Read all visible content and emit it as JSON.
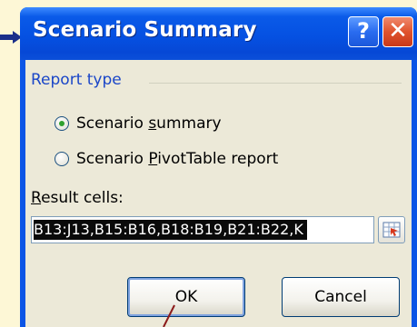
{
  "dialog": {
    "title": "Scenario Summary",
    "help_button": "?",
    "close_button": "✕"
  },
  "report_type": {
    "group_label": "Report type",
    "options": [
      {
        "prefix": "Scenario ",
        "accel": "s",
        "suffix": "ummary",
        "selected": true
      },
      {
        "prefix": "Scenario ",
        "accel": "P",
        "suffix": "ivotTable report",
        "selected": false
      }
    ]
  },
  "result_cells": {
    "label_accel": "R",
    "label_rest": "esult cells:",
    "value": "B13:J13,B15:B16,B18:B19,B21:B22,K"
  },
  "buttons": {
    "ok_label": "OK",
    "cancel_label": "Cancel"
  },
  "colors": {
    "page_background": "#fdf7d6",
    "titlebar": "#0551e2",
    "close_button": "#e0532d",
    "annotation_line": "#8b1a1a"
  }
}
